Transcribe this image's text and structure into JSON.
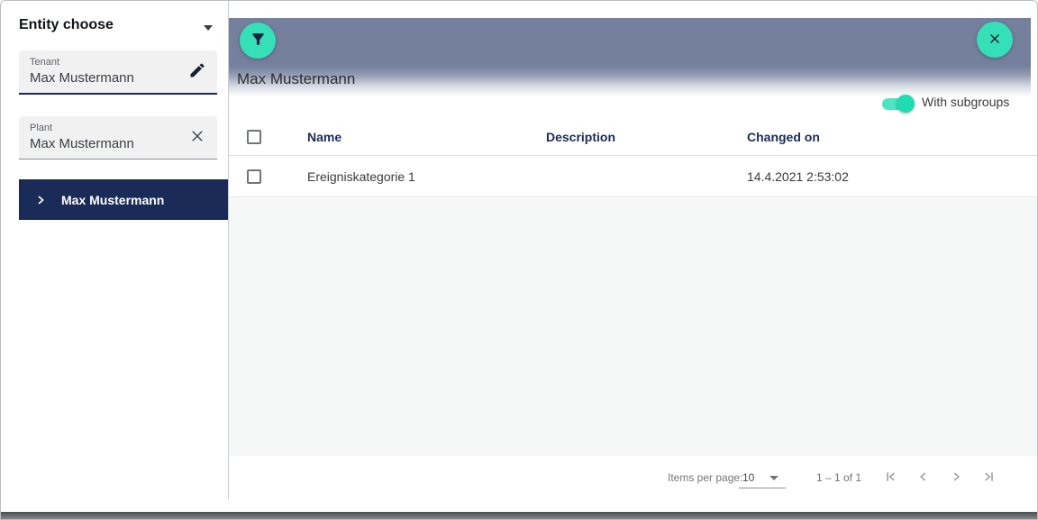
{
  "colors": {
    "accent_teal": "#35E0B8",
    "navy": "#1B2B57",
    "toolbar_slate": "#74809E"
  },
  "sidebar": {
    "title": "Entity choose",
    "tenant_field": {
      "label": "Tenant",
      "value": "Max Mustermann"
    },
    "plant_field": {
      "label": "Plant",
      "value": "Max Mustermann"
    },
    "tree_item": {
      "label": "Max Mustermann"
    }
  },
  "main": {
    "title": "Max Mustermann",
    "subgroups_toggle": {
      "label": "With subgroups",
      "state": "on"
    },
    "table": {
      "columns": [
        "Name",
        "Description",
        "Changed on"
      ],
      "rows": [
        {
          "name": "Ereigniskategorie 1",
          "description": "",
          "changed_on": "14.4.2021 2:53:02"
        }
      ]
    },
    "paginator": {
      "items_per_page_label": "Items per page:",
      "page_size": "10",
      "range_label": "1 – 1 of 1"
    }
  }
}
